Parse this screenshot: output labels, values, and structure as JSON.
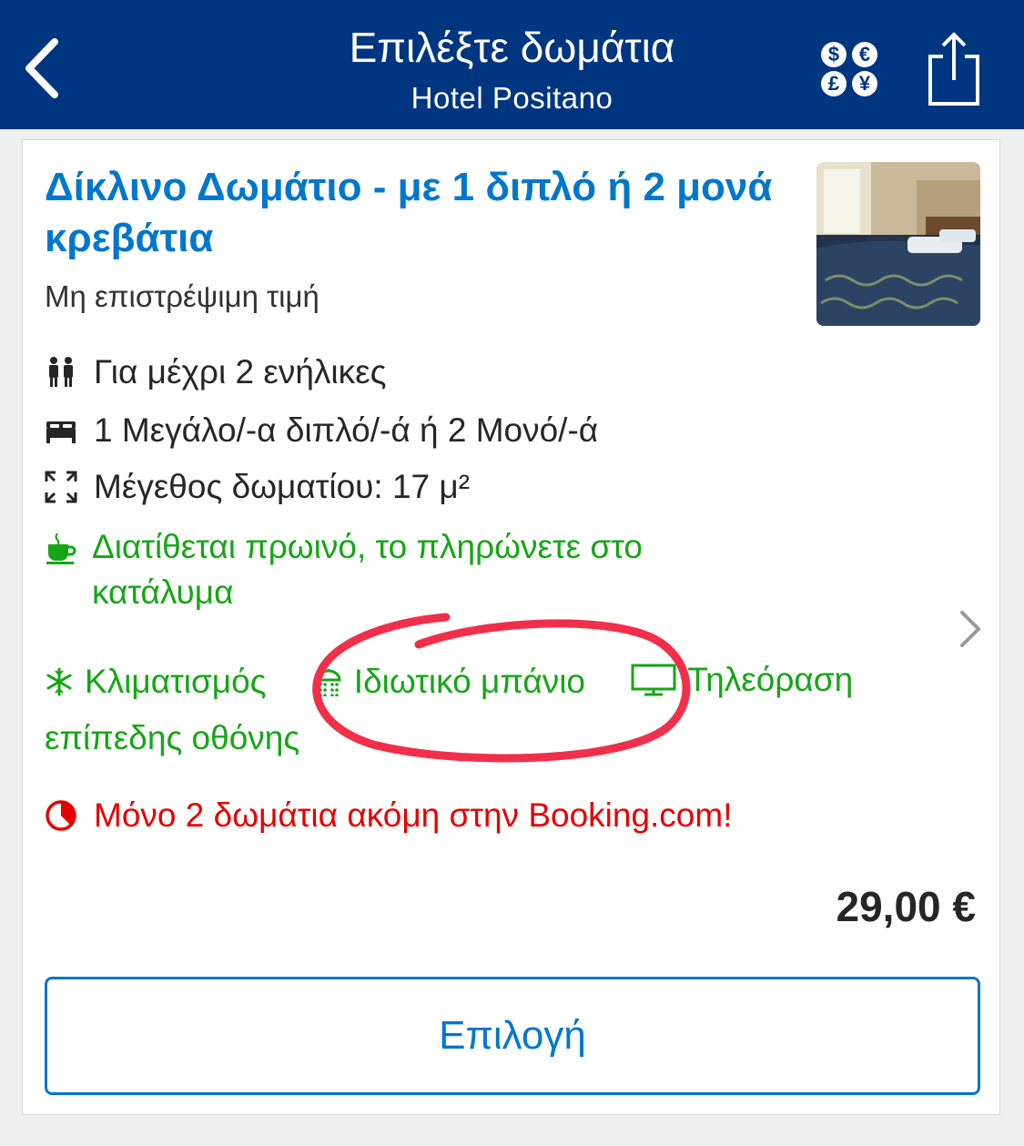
{
  "header": {
    "title": "Επιλέξτε δωμάτια",
    "subtitle": "Hotel Positano",
    "back_icon": "chevron-left-icon",
    "currency_icon": "currency-icon",
    "currency_symbols": [
      "$",
      "€",
      "£",
      "¥"
    ],
    "share_icon": "share-icon",
    "background_color": "#003580"
  },
  "room": {
    "title": "Δίκλινο Δωμάτιο - με 1 διπλό ή 2 μονά κρεβάτια",
    "policy": "Μη επιστρέψιμη τιμή",
    "features": [
      {
        "icon": "people-icon",
        "text": "Για μέχρι 2 ενήλικες"
      },
      {
        "icon": "bed-icon",
        "text": "1 Μεγάλο/-α διπλό/-ά ή 2 Μονό/-ά"
      },
      {
        "icon": "room-size-icon",
        "text": "Μέγεθος δωματίου: 17 μ²"
      }
    ],
    "breakfast": {
      "icon": "coffee-cup-icon",
      "text": "Διατίθεται πρωινό, το πληρώνετε στο κατάλυμα"
    },
    "amenities": [
      {
        "icon": "snowflake-icon",
        "text": "Κλιματισμός"
      },
      {
        "icon": "shower-icon",
        "text": "Ιδιωτικό μπάνιο"
      },
      {
        "icon": "tv-icon",
        "text": "Τηλεόραση"
      }
    ],
    "amenity_tv_continuation": "επίπεδης οθόνης",
    "scarcity": {
      "icon": "clock-pie-icon",
      "text": "Μόνο 2 δωμάτια ακόμη στην Booking.com!"
    },
    "price": "29,00 €",
    "select_label": "Επιλογή"
  },
  "colors": {
    "accent_blue": "#0077cc",
    "green": "#15a615",
    "red": "#e60000",
    "annotation_red": "#f0304a"
  }
}
